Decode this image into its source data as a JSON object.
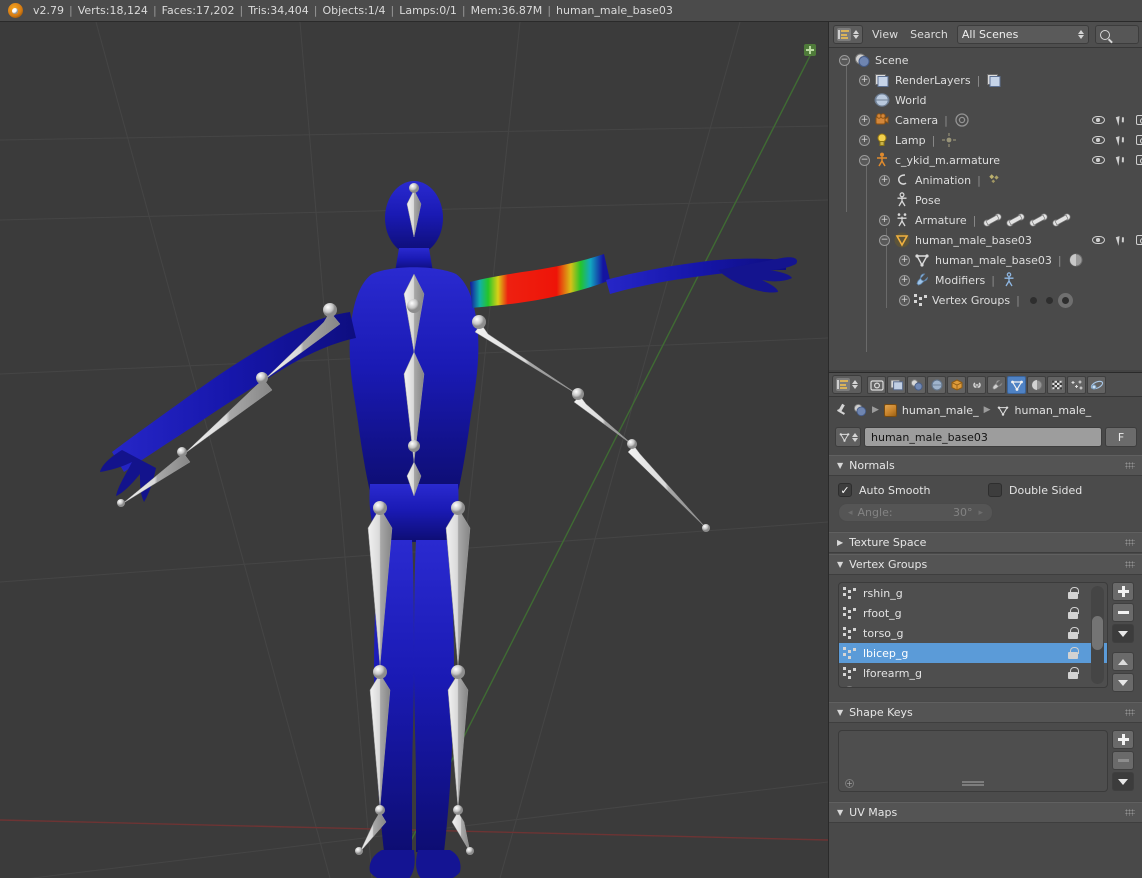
{
  "topbar": {
    "logo_icon": "blender-logo",
    "stats": [
      "v2.79",
      "Verts:18,124",
      "Faces:17,202",
      "Tris:34,404",
      "Objects:1/4",
      "Lamps:0/1",
      "Mem:36.87M",
      "human_male_base03"
    ]
  },
  "viewport": {
    "background_color": "#3b3b3b",
    "axis_marker_icon": "axis-gizmo-icon",
    "grid_color": "#4d4d4d",
    "x_axis_color": "#6d3434",
    "y_axis_color": "#3f6b33",
    "mesh_color": "#1414a8",
    "weight_high_color": "#e51414",
    "weight_mid_color": "#22c12a",
    "bone_color": "#c8c8c8"
  },
  "outliner": {
    "editor_icon": "outliner-editor-icon",
    "menus": [
      "View",
      "Search"
    ],
    "display_mode": "All Scenes",
    "search_icon": "search-icon",
    "tree": [
      {
        "label": "Scene",
        "icon": "scene-icon",
        "depth": 0,
        "expander": "⊖",
        "restrict": false
      },
      {
        "label": "RenderLayers",
        "icon": "renderlayers-icon",
        "depth": 1,
        "expander": "⊕",
        "restrict": false,
        "extra_icon": "renderlayer-data-icon"
      },
      {
        "label": "World",
        "icon": "world-icon",
        "depth": 1,
        "expander": "",
        "restrict": false
      },
      {
        "label": "Camera",
        "icon": "camera-object-icon",
        "depth": 1,
        "expander": "⊕",
        "restrict": true,
        "extra_icon": "camera-data-icon"
      },
      {
        "label": "Lamp",
        "icon": "lamp-object-icon",
        "depth": 1,
        "expander": "⊕",
        "restrict": true,
        "extra_icon": "lamp-data-icon"
      },
      {
        "label": "c_ykid_m.armature",
        "icon": "armature-object-icon",
        "depth": 1,
        "expander": "⊖",
        "restrict": true
      },
      {
        "label": "Animation",
        "icon": "animation-icon",
        "depth": 2,
        "expander": "⊕",
        "restrict": false,
        "extra_icon": "action-icon"
      },
      {
        "label": "Pose",
        "icon": "pose-icon",
        "depth": 2,
        "expander": "",
        "restrict": false
      },
      {
        "label": "Armature",
        "icon": "armature-data-icon",
        "depth": 2,
        "expander": "⊕",
        "restrict": false,
        "bones": 4
      },
      {
        "label": "human_male_base03",
        "icon": "mesh-object-icon",
        "depth": 2,
        "expander": "⊖",
        "restrict": true
      },
      {
        "label": "human_male_base03",
        "icon": "mesh-data-icon",
        "depth": 3,
        "expander": "⊕",
        "restrict": false,
        "extra_icon": "material-icon"
      },
      {
        "label": "Modifiers",
        "icon": "wrench-icon",
        "depth": 3,
        "expander": "⊕",
        "restrict": false,
        "extra_icon": "armature-modifier-icon"
      },
      {
        "label": "Vertex Groups",
        "icon": "vertexgroup-icon",
        "depth": 3,
        "expander": "⊕",
        "restrict": false,
        "dots": 3
      }
    ]
  },
  "properties": {
    "editor_icon": "properties-editor-icon",
    "tabs": [
      {
        "name": "render-tab",
        "icon": "camera-back-icon",
        "active": false
      },
      {
        "name": "render-layers-tab",
        "icon": "images-icon",
        "active": false
      },
      {
        "name": "scene-tab",
        "icon": "scene-cone-icon",
        "active": false
      },
      {
        "name": "world-tab",
        "icon": "world-globe-icon",
        "active": false
      },
      {
        "name": "object-tab",
        "icon": "orange-cube-icon",
        "active": false
      },
      {
        "name": "constraints-tab",
        "icon": "chain-link-icon",
        "active": false
      },
      {
        "name": "modifiers-tab",
        "icon": "wrench-icon",
        "active": false
      },
      {
        "name": "object-data-tab",
        "icon": "green-triangle-mesh-icon",
        "active": true
      },
      {
        "name": "material-tab",
        "icon": "material-sphere-icon",
        "active": false
      },
      {
        "name": "texture-tab",
        "icon": "checker-texture-icon",
        "active": false
      },
      {
        "name": "particles-tab",
        "icon": "particles-icon",
        "active": false
      },
      {
        "name": "physics-tab",
        "icon": "physics-orbit-icon",
        "active": false
      }
    ],
    "breadcrumb": {
      "pin_icon": "pin-icon",
      "scene_icon": "scene-icon",
      "object": "human_male_",
      "data": "human_male_"
    },
    "name_field": {
      "mesh_icon": "mesh-data-icon",
      "value": "human_male_base03",
      "fake_user_label": "F"
    },
    "panels": {
      "normals": {
        "title": "Normals",
        "expanded": true,
        "auto_smooth": {
          "label": "Auto Smooth",
          "checked": true
        },
        "double_sided": {
          "label": "Double Sided",
          "checked": false
        },
        "angle": {
          "label": "Angle:",
          "value": "30°",
          "enabled": false
        }
      },
      "texture_space": {
        "title": "Texture Space",
        "expanded": false
      },
      "vertex_groups": {
        "title": "Vertex Groups",
        "expanded": true,
        "items": [
          {
            "name": "rshin_g",
            "selected": false,
            "lock_icon": "unlocked-icon"
          },
          {
            "name": "rfoot_g",
            "selected": false,
            "lock_icon": "unlocked-icon"
          },
          {
            "name": "torso_g",
            "selected": false,
            "lock_icon": "unlocked-icon"
          },
          {
            "name": "lbicep_g",
            "selected": true,
            "lock_icon": "unlocked-icon"
          },
          {
            "name": "lforearm_g",
            "selected": false,
            "lock_icon": "unlocked-icon"
          }
        ],
        "buttons": [
          "add",
          "remove",
          "specials",
          "move-up",
          "move-down"
        ]
      },
      "shape_keys": {
        "title": "Shape Keys",
        "expanded": true,
        "items": [],
        "buttons": [
          "add",
          "remove",
          "specials"
        ]
      },
      "uv_maps": {
        "title": "UV Maps",
        "expanded": true
      }
    }
  }
}
